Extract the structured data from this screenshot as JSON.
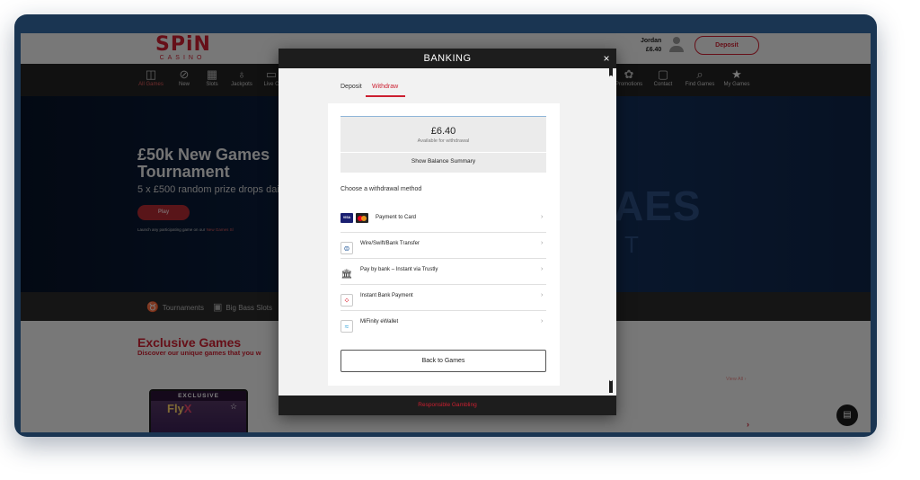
{
  "site": {
    "logo_main": "SPiN",
    "logo_sub": "CASINO",
    "user_name": "Jordan",
    "user_balance": "£6.40",
    "deposit_label": "Deposit"
  },
  "nav": {
    "items": [
      {
        "label": "All Games",
        "icon": "grid-icon",
        "glyph": "◫"
      },
      {
        "label": "New",
        "icon": "tag-icon",
        "glyph": "⊘"
      },
      {
        "label": "Slots",
        "icon": "slots-icon",
        "glyph": "▦"
      },
      {
        "label": "Jackpots",
        "icon": "moneybag-icon",
        "glyph": "♁"
      },
      {
        "label": "Live C",
        "icon": "live-icon",
        "glyph": "▭"
      },
      {
        "label": "Promotions",
        "icon": "gift-icon",
        "glyph": "✿"
      },
      {
        "label": "Contact",
        "icon": "chat-icon",
        "glyph": "▢"
      },
      {
        "label": "Find Games",
        "icon": "search-icon",
        "glyph": "⌕"
      },
      {
        "label": "My Games",
        "icon": "star-icon",
        "glyph": "★"
      }
    ]
  },
  "hero": {
    "title": "£50k New Games Tournament",
    "subtitle": "5 x £500 random prize drops dai",
    "play_label": "Play",
    "note": "Launch any participating game on our ",
    "note_link": "New Games Sl",
    "bg_mark": "AES",
    "bg_mark2": "T"
  },
  "strip": {
    "items": [
      {
        "label": "Tournaments",
        "icon": "trophy-icon",
        "glyph": "♉"
      },
      {
        "label": "Big Bass Slots",
        "icon": "slot-machine-icon",
        "glyph": "▣"
      }
    ]
  },
  "exclusive": {
    "title": "Exclusive Games",
    "subtitle": "Discover our unique games that you w",
    "view_all": "View All ›",
    "tile_tag": "EXCLUSIVE",
    "tile_name_a": "Fly",
    "tile_name_b": "X",
    "arrow": "›"
  },
  "modal": {
    "title": "BANKING",
    "close": "×",
    "tabs": [
      "Deposit",
      "Withdraw"
    ],
    "active_tab": "Withdraw",
    "balance": "£6.40",
    "balance_sub": "Available for withdrawal",
    "summary_label": "Show Balance Summary",
    "choose_label": "Choose a withdrawal method",
    "methods": [
      {
        "label": "Payment to Card",
        "icon": "visa-mastercard-icon"
      },
      {
        "label": "Wire/Swift/Bank Transfer",
        "icon": "bank-transfer-icon",
        "glyph": "⊜"
      },
      {
        "label": "Pay by bank – Instant via Trustly",
        "icon": "bank-building-icon",
        "glyph": "🏛"
      },
      {
        "label": "Instant Bank Payment",
        "icon": "instant-bank-icon",
        "glyph": "⁘"
      },
      {
        "label": "MiFinity eWallet",
        "icon": "mifinity-icon",
        "glyph": "≈"
      }
    ],
    "chevron": "›",
    "back_label": "Back to Games",
    "footer": "Responsible Gambling"
  },
  "colors": {
    "brand_red": "#cc1f30",
    "frame": "#1a3552",
    "modal_header": "#1d1d1d"
  }
}
